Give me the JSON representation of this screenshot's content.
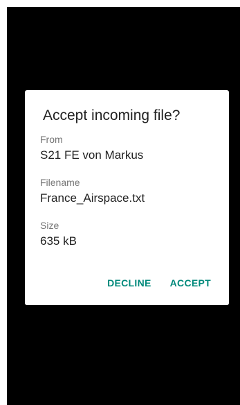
{
  "dialog": {
    "title": "Accept incoming file?",
    "fields": [
      {
        "label": "From",
        "value": "S21 FE von Markus"
      },
      {
        "label": "Filename",
        "value": "France_Airspace.txt"
      },
      {
        "label": "Size",
        "value": "635 kB"
      }
    ],
    "actions": {
      "decline_label": "DECLINE",
      "accept_label": "ACCEPT"
    }
  },
  "colors": {
    "background": "#000000",
    "dialog": "#ffffff",
    "accent": "#00897b",
    "primary_text": "#212121",
    "secondary_text": "#757575"
  }
}
